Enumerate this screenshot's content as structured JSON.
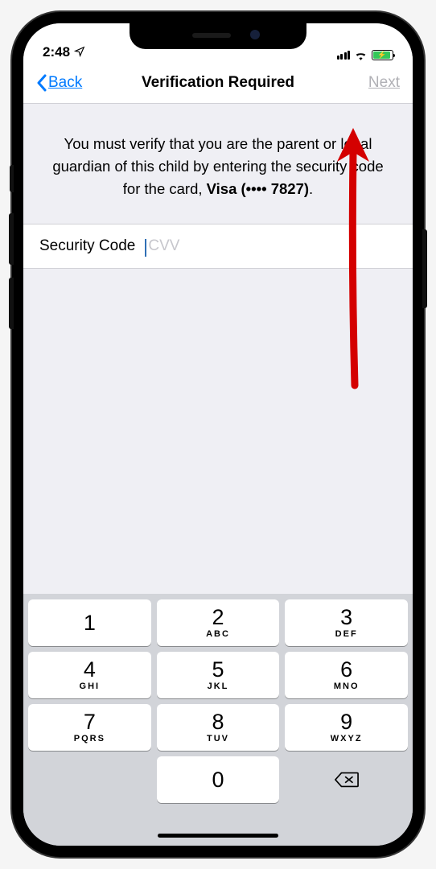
{
  "status": {
    "time": "2:48",
    "location_icon": "location-arrow",
    "signal": 4,
    "wifi": true,
    "battery_charging": true
  },
  "nav": {
    "back": "Back",
    "title": "Verification Required",
    "next": "Next"
  },
  "body": {
    "instruction_prefix": "You must verify that you are the parent or legal guardian of this child by entering the security code for the card, ",
    "card_label": "Visa (•••• 7827)",
    "instruction_suffix": ".",
    "field_label": "Security Code",
    "placeholder": "CVV",
    "value": ""
  },
  "keypad": {
    "rows": [
      [
        {
          "n": "1",
          "l": ""
        },
        {
          "n": "2",
          "l": "ABC"
        },
        {
          "n": "3",
          "l": "DEF"
        }
      ],
      [
        {
          "n": "4",
          "l": "GHI"
        },
        {
          "n": "5",
          "l": "JKL"
        },
        {
          "n": "6",
          "l": "MNO"
        }
      ],
      [
        {
          "n": "7",
          "l": "PQRS"
        },
        {
          "n": "8",
          "l": "TUV"
        },
        {
          "n": "9",
          "l": "WXYZ"
        }
      ],
      [
        {
          "n": "",
          "l": "",
          "empty": true
        },
        {
          "n": "0",
          "l": ""
        },
        {
          "n": "",
          "l": "",
          "backspace": true
        }
      ]
    ]
  }
}
